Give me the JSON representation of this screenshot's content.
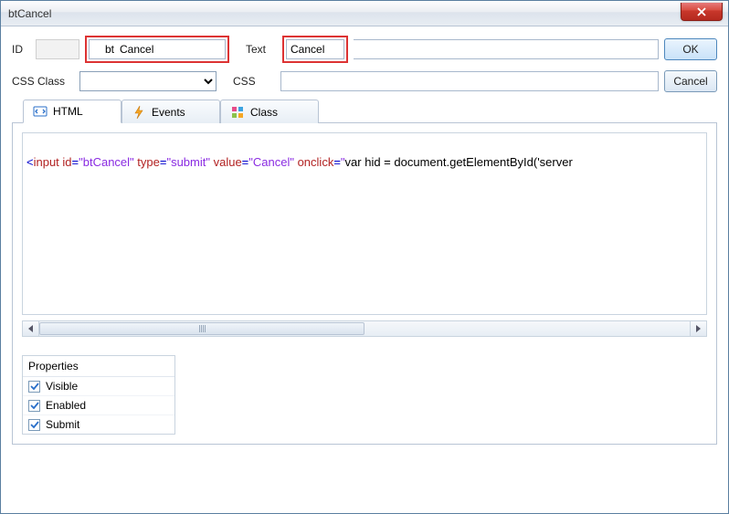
{
  "window": {
    "title": "btCancel",
    "buttons": {
      "ok": "OK",
      "cancel": "Cancel"
    }
  },
  "form": {
    "id_label": "ID",
    "id_prefix": "bt",
    "id_value": "Cancel",
    "text_label": "Text",
    "text_value": "Cancel",
    "cssclass_label": "CSS Class",
    "cssclass_value": "",
    "css_label": "CSS",
    "css_value": ""
  },
  "tabs": {
    "html": "HTML",
    "events": "Events",
    "class": "Class"
  },
  "code": {
    "tokens": [
      {
        "c": "p",
        "t": "<"
      },
      {
        "c": "a",
        "t": "input "
      },
      {
        "c": "a",
        "t": "id"
      },
      {
        "c": "e",
        "t": "="
      },
      {
        "c": "v",
        "t": "\"btCancel\" "
      },
      {
        "c": "a",
        "t": "type"
      },
      {
        "c": "e",
        "t": "="
      },
      {
        "c": "v",
        "t": "\"submit\" "
      },
      {
        "c": "a",
        "t": "value"
      },
      {
        "c": "e",
        "t": "="
      },
      {
        "c": "v",
        "t": "\"Cancel\" "
      },
      {
        "c": "a",
        "t": "onclick"
      },
      {
        "c": "e",
        "t": "="
      },
      {
        "c": "v",
        "t": "\""
      },
      {
        "c": "t",
        "t": "var hid = document.getElementById('server"
      }
    ]
  },
  "properties": {
    "title": "Properties",
    "items": [
      {
        "label": "Visible",
        "checked": true
      },
      {
        "label": "Enabled",
        "checked": true
      },
      {
        "label": "Submit",
        "checked": true
      }
    ]
  }
}
